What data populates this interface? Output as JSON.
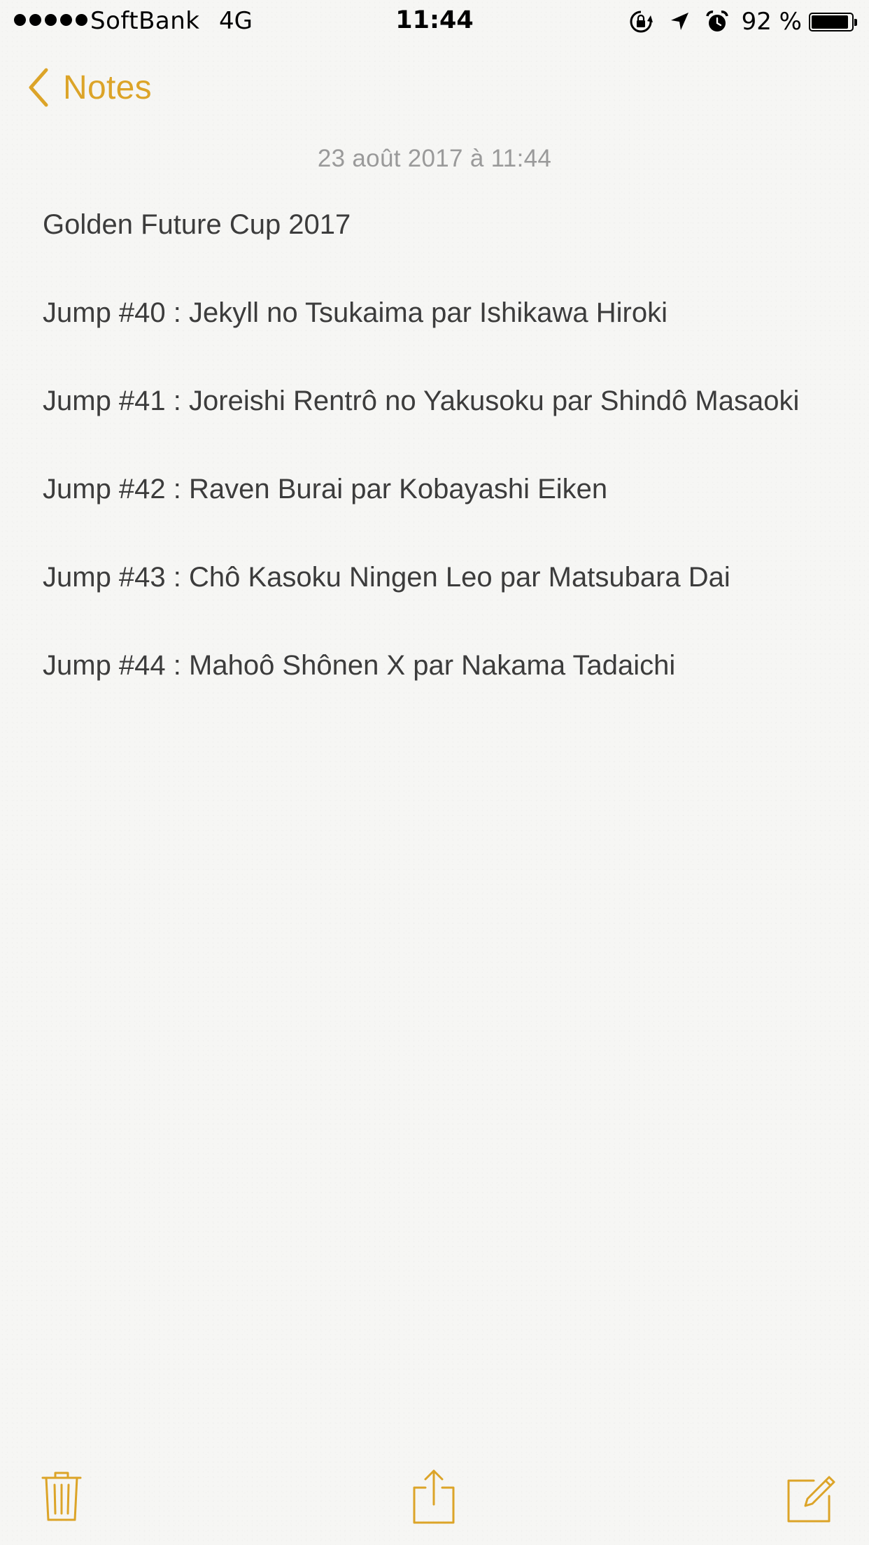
{
  "status_bar": {
    "carrier": "SoftBank",
    "network": "4G",
    "time": "11:44",
    "battery_percent": "92 %",
    "battery_level": 0.92,
    "icons": [
      "signal-dots-icon",
      "rotation-lock-icon",
      "location-arrow-icon",
      "alarm-clock-icon",
      "battery-icon"
    ]
  },
  "nav": {
    "back_label": "Notes",
    "accent_color": "#dca428"
  },
  "note": {
    "date": "23 août 2017 à 11:44",
    "lines": [
      "Golden Future Cup 2017",
      "Jump #40 : Jekyll no Tsukaima par Ishikawa Hiroki",
      "Jump #41 : Joreishi Rentrô no Yakusoku par Shindô Masaoki",
      "Jump #42 : Raven Burai par Kobayashi Eiken",
      "Jump #43 : Chô Kasoku Ningen Leo par Matsubara Dai",
      "Jump #44 : Mahoô Shônen X par Nakama Tadaichi"
    ]
  },
  "toolbar": {
    "icons": [
      "trash-icon",
      "share-icon",
      "compose-icon"
    ]
  }
}
